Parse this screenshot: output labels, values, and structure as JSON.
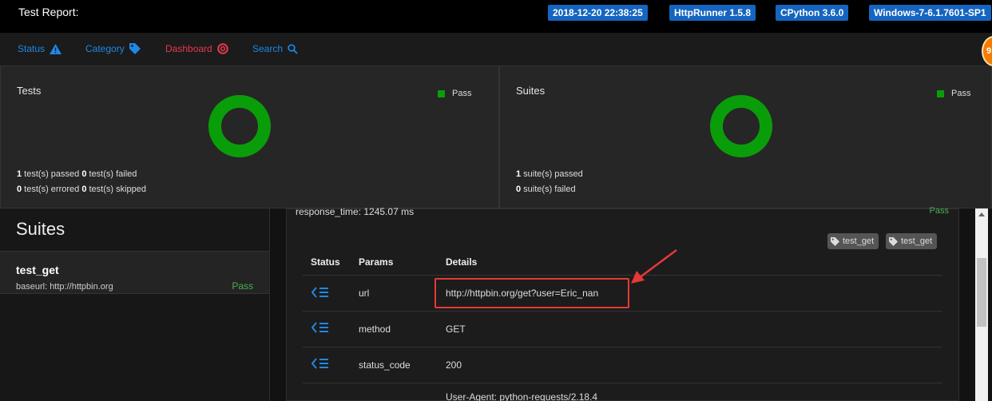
{
  "header": {
    "title": "Test Report:",
    "badges": [
      "2018-12-20 22:38:25",
      "HttpRunner 1.5.8",
      "CPython 3.6.0",
      "Windows-7-6.1.7601-SP1"
    ]
  },
  "nav": {
    "status": "Status",
    "category": "Category",
    "dashboard": "Dashboard",
    "search": "Search"
  },
  "colors": {
    "accent": "#1e88e5",
    "dashboard": "#e53950",
    "pass": "#0a9d0a",
    "highlight": "#e53935"
  },
  "tests_panel": {
    "title": "Tests",
    "legend": "Pass",
    "line1": {
      "n1": "1",
      "t1": " test(s) passed ",
      "n2": "0",
      "t2": " test(s) failed"
    },
    "line2": {
      "n1": "0",
      "t1": " test(s) errored ",
      "n2": "0",
      "t2": " test(s) skipped"
    }
  },
  "suites_panel": {
    "title": "Suites",
    "legend": "Pass",
    "line1": {
      "n1": "1",
      "t1": " suite(s) passed"
    },
    "line2": {
      "n1": "0",
      "t1": " suite(s) failed"
    }
  },
  "sidebar": {
    "heading": "Suites",
    "suite": {
      "name": "test_get",
      "baseurl": "baseurl: http://httpbin.org",
      "status": "Pass"
    }
  },
  "detail": {
    "response_time": "response_time: 1245.07 ms",
    "status": "Pass",
    "tags": [
      "test_get",
      "test_get"
    ],
    "columns": {
      "status": "Status",
      "params": "Params",
      "details": "Details"
    },
    "rows": [
      {
        "param": "url",
        "value": "http://httpbin.org/get?user=Eric_nan"
      },
      {
        "param": "method",
        "value": "GET"
      },
      {
        "param": "status_code",
        "value": "200"
      },
      {
        "param": "",
        "value": "User-Agent: python-requests/2.18.4"
      }
    ]
  }
}
